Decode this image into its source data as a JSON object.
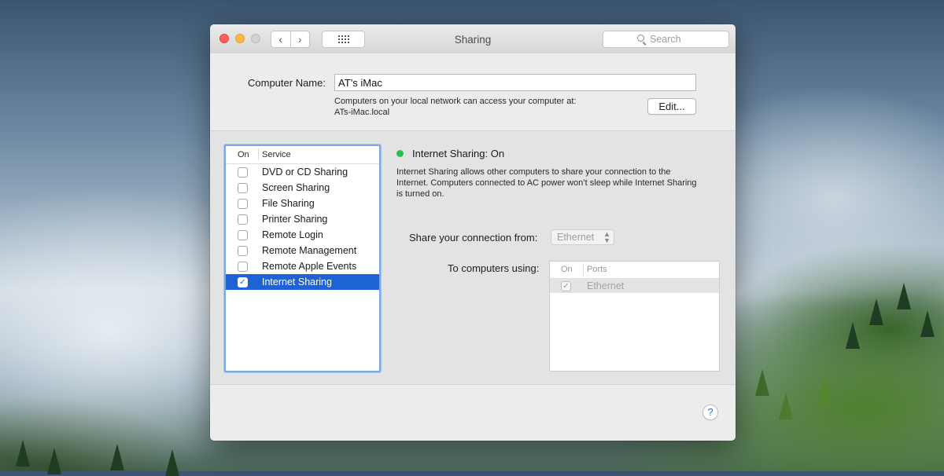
{
  "window": {
    "title": "Sharing",
    "search_placeholder": "Search"
  },
  "computer_name": {
    "label": "Computer Name:",
    "value": "AT’s iMac",
    "info_line1": "Computers on your local network can access your computer at:",
    "info_line2": "ATs-iMac.local",
    "edit_button": "Edit..."
  },
  "services": {
    "header_on": "On",
    "header_service": "Service",
    "items": [
      {
        "label": "DVD or CD Sharing",
        "checked": false,
        "selected": false
      },
      {
        "label": "Screen Sharing",
        "checked": false,
        "selected": false
      },
      {
        "label": "File Sharing",
        "checked": false,
        "selected": false
      },
      {
        "label": "Printer Sharing",
        "checked": false,
        "selected": false
      },
      {
        "label": "Remote Login",
        "checked": false,
        "selected": false
      },
      {
        "label": "Remote Management",
        "checked": false,
        "selected": false
      },
      {
        "label": "Remote Apple Events",
        "checked": false,
        "selected": false
      },
      {
        "label": "Internet Sharing",
        "checked": true,
        "selected": true
      }
    ]
  },
  "detail": {
    "status_title": "Internet Sharing: On",
    "status_color": "#2ac24a",
    "description": "Internet Sharing allows other computers to share your connection to the Internet. Computers connected to AC power won’t sleep while Internet Sharing is turned on.",
    "share_from_label": "Share your connection from:",
    "share_from_value": "Ethernet",
    "to_computers_label": "To computers using:",
    "ports_header_on": "On",
    "ports_header_ports": "Ports",
    "ports": [
      {
        "label": "Ethernet",
        "checked": true,
        "disabled": true
      }
    ]
  },
  "help_button": "?",
  "colors": {
    "selection": "#1c63d4",
    "focus_ring": "#7ba8e3"
  }
}
